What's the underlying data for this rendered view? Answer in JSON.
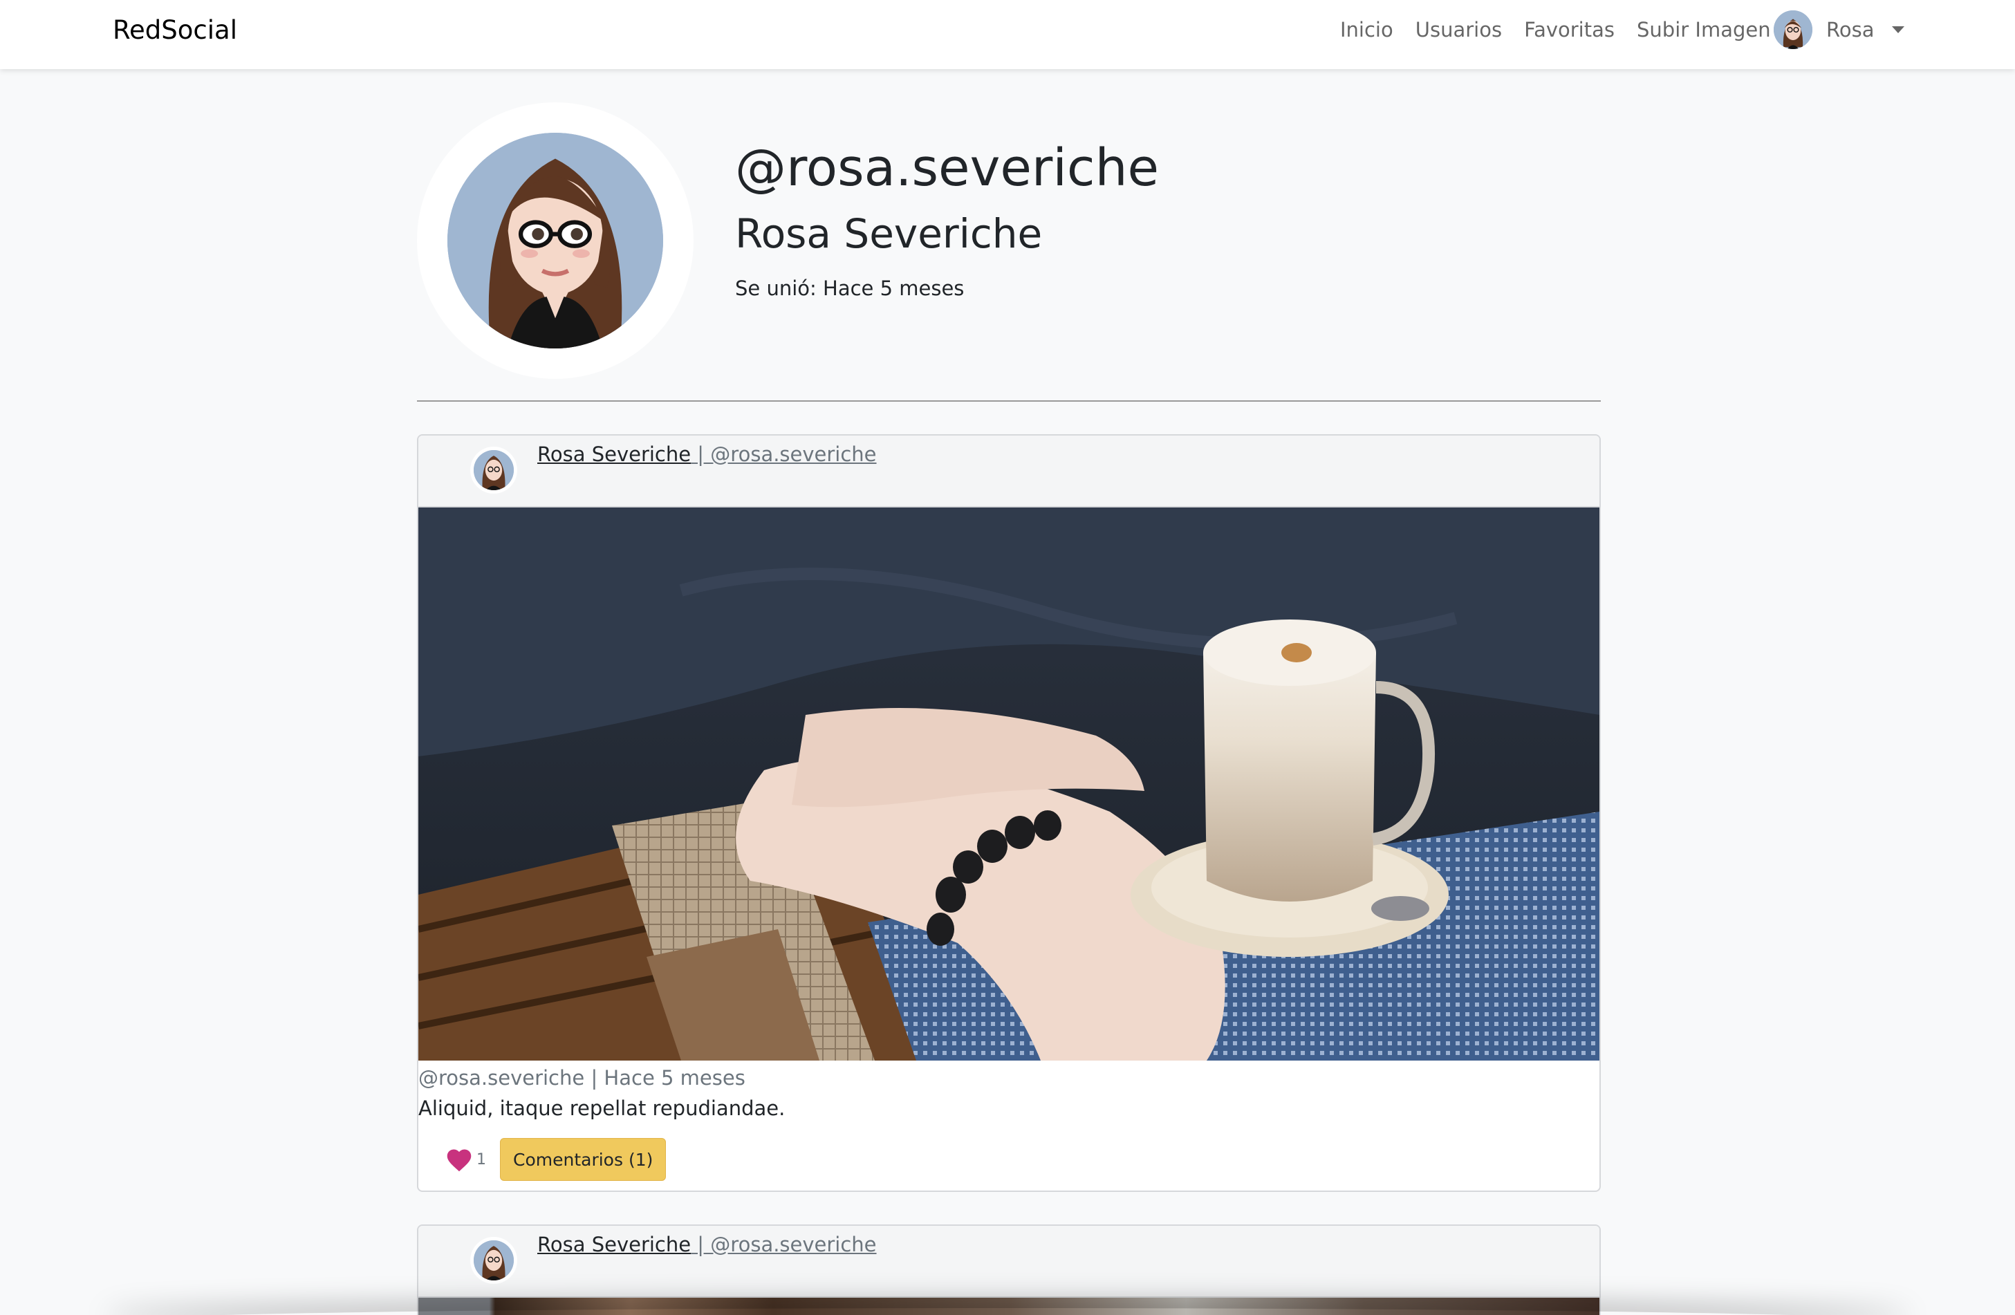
{
  "navbar": {
    "brand": "RedSocial",
    "links": [
      "Inicio",
      "Usuarios",
      "Favoritas",
      "Subir Imagen"
    ],
    "user_label": "Rosa"
  },
  "profile": {
    "username": "@rosa.severiche",
    "full_name": "Rosa Severiche",
    "joined": "Se unió: Hace 5 meses"
  },
  "posts": [
    {
      "author_name": "Rosa Severiche",
      "author_handle": " | @rosa.severiche",
      "meta": "@rosa.severiche | Hace 5 meses",
      "description": "Aliquid, itaque repellat repudiandae.",
      "likes": "1",
      "comments_label": "Comentarios (1)"
    },
    {
      "author_name": "Rosa Severiche",
      "author_handle": " | @rosa.severiche"
    }
  ],
  "colors": {
    "heart": "#c8327e",
    "comments_button": "#f0c95d",
    "page_background": "#f8f9fa"
  }
}
